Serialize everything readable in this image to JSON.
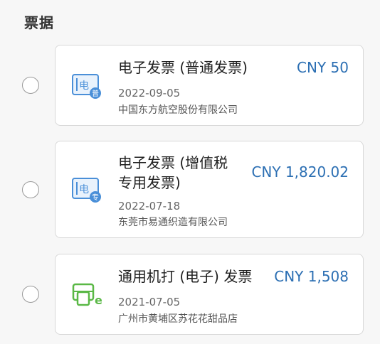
{
  "section": {
    "title": "票据"
  },
  "invoices": [
    {
      "title_line1": "电子发票 (普通发票)",
      "title_line2": "",
      "amount": "CNY 50",
      "date": "2022-09-05",
      "vendor": "中国东方航空股份有限公司",
      "icon": "e-invoice-general-icon",
      "icon_main_char": "电",
      "icon_badge_char": "普"
    },
    {
      "title_line1": "电子发票 (增值税",
      "title_line2": "专用发票)",
      "amount": "CNY 1,820.02",
      "date": "2022-07-18",
      "vendor": "东莞市易通织造有限公司",
      "icon": "e-invoice-vat-special-icon",
      "icon_main_char": "电",
      "icon_badge_char": "专"
    },
    {
      "title_line1": "通用机打 (电子) 发票",
      "title_line2": "",
      "amount": "CNY 1,508",
      "date": "2021-07-05",
      "vendor": "广州市黄埔区苏花花甜品店",
      "icon": "machine-printed-e-invoice-icon",
      "icon_main_char": "",
      "icon_badge_char": "e"
    }
  ],
  "colors": {
    "accent_blue": "#2c6fb3",
    "icon_blue": "#4a8fd8",
    "icon_green": "#5ab846"
  }
}
